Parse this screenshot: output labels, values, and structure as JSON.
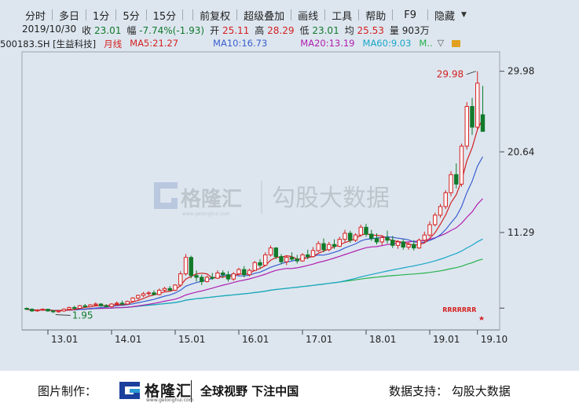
{
  "toolbar": {
    "tabs": [
      "分时",
      "多日",
      "1分",
      "5分",
      "15分"
    ],
    "actions": [
      "前复权",
      "超级叠加",
      "画线",
      "工具",
      "帮助",
      "F9",
      "隐藏"
    ]
  },
  "info": {
    "date": "2019/10/30",
    "close_label": "收",
    "close": "23.01",
    "change_label": "幅",
    "change": "-7.74%(-1.93)",
    "open_label": "开",
    "open": "25.11",
    "high_label": "高",
    "high": "28.29",
    "low_label": "低",
    "low": "23.01",
    "avg_label": "均",
    "avg": "25.53",
    "vol_label": "量",
    "vol": "903万"
  },
  "ma_bar": {
    "code": "500183.SH [生益科技]",
    "period": "月线",
    "ma5": "MA5:21.27",
    "ma10": "MA10:16.73",
    "ma20": "MA20:13.19",
    "ma60": "MA60:9.03",
    "more": "M..",
    "colors": {
      "code": "#222222",
      "period": "#d42020",
      "ma5": "#d42020",
      "ma10": "#3a5ed0",
      "ma20": "#b020b0",
      "ma60": "#1aa6c8"
    }
  },
  "chart_data": {
    "type": "candlestick",
    "y_ticks": [
      11.29,
      20.64,
      29.98
    ],
    "ylim": [
      2.0,
      31.5
    ],
    "x_ticks": [
      "13.01",
      "14.01",
      "15.01",
      "16.01",
      "17.01",
      "18.01",
      "19.01",
      "19.10"
    ],
    "annotations": {
      "max_label": "29.98",
      "min_label": "1.95",
      "marker_text": "RRRRRRR"
    },
    "colors": {
      "up": "#d42020",
      "down": "#117a2b",
      "ma5": "#d42020",
      "ma10": "#3a5ed0",
      "ma20": "#b020b0",
      "ma60": "#1aa6c8",
      "ma120": "#23b24a"
    },
    "month_start": "2012-09",
    "ohlc": [
      [
        2.5,
        2.6,
        2.3,
        2.4
      ],
      [
        2.4,
        2.5,
        2.1,
        2.2
      ],
      [
        2.2,
        2.4,
        2.1,
        2.3
      ],
      [
        2.3,
        2.5,
        2.2,
        2.4
      ],
      [
        2.4,
        2.4,
        2.1,
        2.2
      ],
      [
        2.2,
        2.3,
        1.95,
        2.1
      ],
      [
        2.1,
        2.3,
        2.0,
        2.2
      ],
      [
        2.2,
        2.5,
        2.1,
        2.4
      ],
      [
        2.4,
        2.7,
        2.3,
        2.6
      ],
      [
        2.6,
        2.8,
        2.4,
        2.5
      ],
      [
        2.5,
        2.9,
        2.4,
        2.8
      ],
      [
        2.8,
        3.0,
        2.6,
        2.7
      ],
      [
        2.7,
        3.0,
        2.6,
        2.9
      ],
      [
        2.9,
        3.2,
        2.8,
        3.0
      ],
      [
        3.0,
        3.1,
        2.7,
        2.8
      ],
      [
        2.8,
        3.0,
        2.6,
        2.7
      ],
      [
        2.7,
        3.1,
        2.6,
        3.0
      ],
      [
        3.0,
        3.3,
        2.8,
        3.1
      ],
      [
        3.1,
        3.4,
        2.9,
        3.0
      ],
      [
        3.0,
        3.4,
        2.9,
        3.3
      ],
      [
        3.3,
        3.8,
        3.2,
        3.7
      ],
      [
        3.7,
        4.1,
        3.5,
        4.0
      ],
      [
        4.0,
        4.4,
        3.8,
        4.2
      ],
      [
        4.2,
        4.5,
        4.0,
        4.3
      ],
      [
        4.3,
        4.6,
        4.0,
        4.1
      ],
      [
        4.1,
        4.8,
        4.0,
        4.6
      ],
      [
        4.6,
        5.0,
        4.4,
        4.8
      ],
      [
        4.8,
        5.1,
        4.5,
        4.6
      ],
      [
        4.6,
        5.3,
        4.5,
        5.2
      ],
      [
        5.2,
        6.8,
        5.0,
        6.5
      ],
      [
        6.5,
        8.8,
        6.3,
        8.4
      ],
      [
        8.4,
        8.6,
        6.0,
        6.3
      ],
      [
        6.3,
        6.9,
        5.6,
        6.1
      ],
      [
        6.1,
        6.4,
        5.2,
        5.6
      ],
      [
        5.6,
        6.3,
        5.5,
        6.1
      ],
      [
        6.1,
        6.6,
        5.8,
        6.0
      ],
      [
        6.0,
        6.9,
        5.9,
        6.6
      ],
      [
        6.6,
        6.9,
        6.0,
        6.4
      ],
      [
        6.4,
        6.8,
        5.6,
        5.9
      ],
      [
        5.9,
        6.7,
        5.7,
        6.5
      ],
      [
        6.5,
        7.2,
        6.3,
        7.0
      ],
      [
        7.0,
        7.4,
        6.1,
        6.4
      ],
      [
        6.4,
        7.1,
        6.2,
        6.9
      ],
      [
        6.9,
        8.0,
        6.8,
        7.8
      ],
      [
        7.8,
        8.2,
        7.2,
        7.5
      ],
      [
        7.5,
        9.0,
        7.4,
        8.7
      ],
      [
        8.7,
        9.8,
        8.5,
        9.5
      ],
      [
        9.5,
        9.6,
        8.2,
        8.5
      ],
      [
        8.5,
        8.8,
        7.6,
        7.9
      ],
      [
        7.9,
        8.6,
        7.5,
        8.4
      ],
      [
        8.4,
        9.0,
        8.0,
        8.2
      ],
      [
        8.2,
        8.7,
        7.7,
        8.0
      ],
      [
        8.0,
        8.9,
        7.9,
        8.7
      ],
      [
        8.7,
        9.3,
        8.2,
        8.5
      ],
      [
        8.5,
        9.6,
        8.4,
        9.2
      ],
      [
        9.2,
        10.3,
        9.0,
        10.0
      ],
      [
        10.0,
        10.6,
        9.0,
        9.3
      ],
      [
        9.3,
        10.2,
        9.1,
        9.9
      ],
      [
        9.9,
        10.5,
        9.4,
        9.7
      ],
      [
        9.7,
        10.8,
        9.6,
        10.5
      ],
      [
        10.5,
        11.6,
        10.2,
        11.2
      ],
      [
        11.2,
        11.5,
        10.1,
        10.4
      ],
      [
        10.4,
        11.2,
        10.2,
        11.0
      ],
      [
        11.0,
        12.2,
        10.8,
        11.9
      ],
      [
        11.9,
        12.3,
        10.8,
        11.1
      ],
      [
        11.1,
        11.6,
        10.3,
        10.6
      ],
      [
        10.6,
        11.2,
        9.9,
        10.2
      ],
      [
        10.2,
        11.0,
        9.8,
        10.7
      ],
      [
        10.7,
        11.5,
        10.0,
        10.4
      ],
      [
        10.4,
        10.9,
        9.5,
        9.8
      ],
      [
        9.8,
        10.4,
        9.4,
        10.2
      ],
      [
        10.2,
        10.5,
        9.3,
        9.6
      ],
      [
        9.6,
        10.2,
        9.3,
        9.9
      ],
      [
        9.9,
        10.4,
        9.2,
        9.5
      ],
      [
        9.5,
        10.6,
        9.4,
        10.4
      ],
      [
        10.4,
        11.4,
        10.2,
        11.0
      ],
      [
        11.0,
        12.6,
        10.8,
        12.2
      ],
      [
        12.2,
        13.6,
        12.0,
        13.3
      ],
      [
        13.3,
        14.6,
        13.0,
        14.3
      ],
      [
        14.3,
        16.2,
        14.0,
        15.9
      ],
      [
        15.9,
        18.4,
        15.5,
        18.0
      ],
      [
        18.0,
        19.3,
        16.4,
        16.9
      ],
      [
        16.9,
        21.6,
        16.6,
        21.3
      ],
      [
        21.3,
        26.4,
        20.9,
        25.9
      ],
      [
        25.9,
        26.9,
        22.6,
        23.5
      ],
      [
        23.5,
        29.98,
        23.2,
        28.6
      ],
      [
        24.94,
        28.29,
        23.01,
        23.01
      ]
    ]
  },
  "footer": {
    "made_label": "图片制作：",
    "brand": "格隆汇",
    "brand_sub": "www.gelonghui.com",
    "slogan": "全球视野 下注中国",
    "support": "数据支持： 勾股大数据"
  },
  "watermark": {
    "brand": "格隆汇",
    "brand_sub": "www.gelonghui.com",
    "text": "勾股大数据"
  }
}
